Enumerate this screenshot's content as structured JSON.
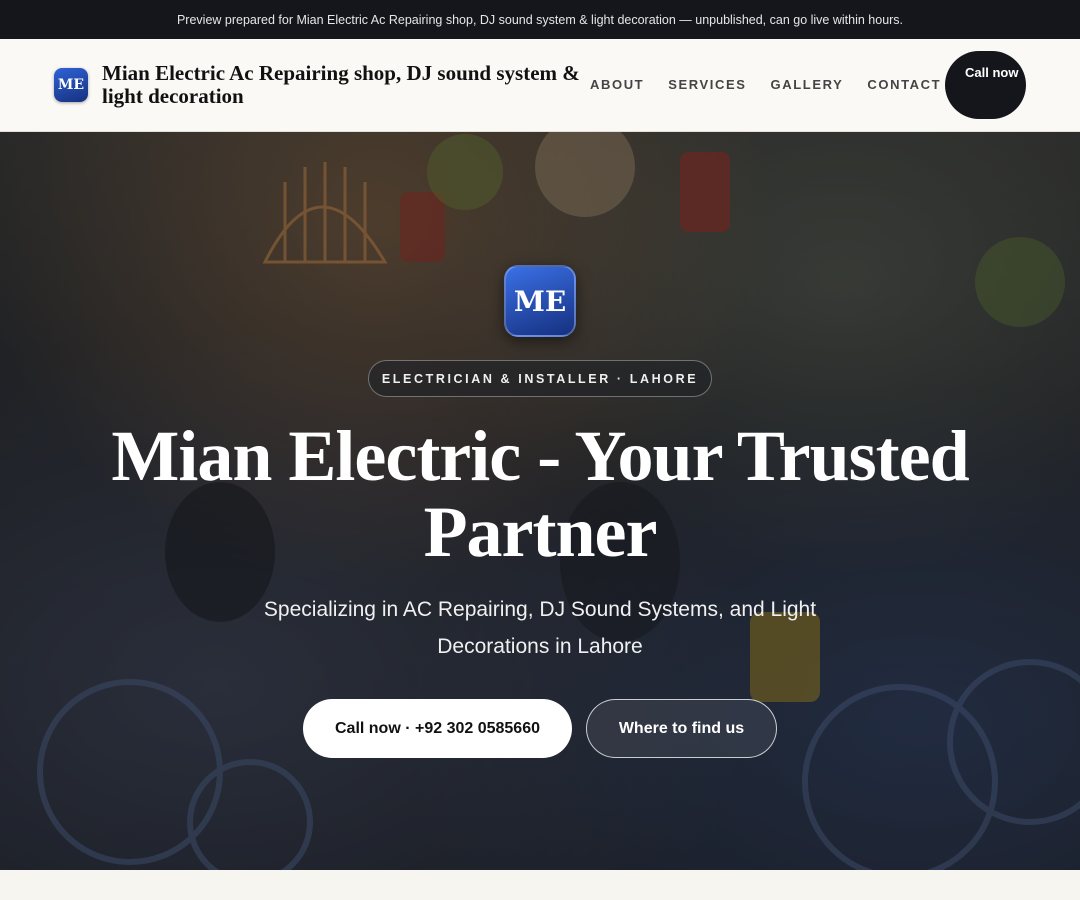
{
  "preview_bar": {
    "text": "Preview prepared for Mian Electric Ac Repairing shop, DJ sound system & light decoration — unpublished, can go live within hours."
  },
  "header": {
    "logo_initials": "ME",
    "brand_name": "Mian Electric Ac Repairing shop, DJ sound system & light decoration",
    "nav": [
      {
        "label": "ABOUT"
      },
      {
        "label": "SERVICES"
      },
      {
        "label": "GALLERY"
      },
      {
        "label": "CONTACT"
      }
    ],
    "call_button": "Call now"
  },
  "hero": {
    "logo_initials": "ME",
    "badge": "ELECTRICIAN & INSTALLER · LAHORE",
    "title": "Mian Electric - Your Trusted Partner",
    "subtitle": "Specializing in AC Repairing, DJ Sound Systems, and Light Decorations in Lahore",
    "primary_button": "Call now · +92 302 0585660",
    "secondary_button": "Where to find us"
  },
  "colors": {
    "dark": "#14161b",
    "accent_blue": "#2f63d6",
    "header_bg": "#faf9f6"
  }
}
